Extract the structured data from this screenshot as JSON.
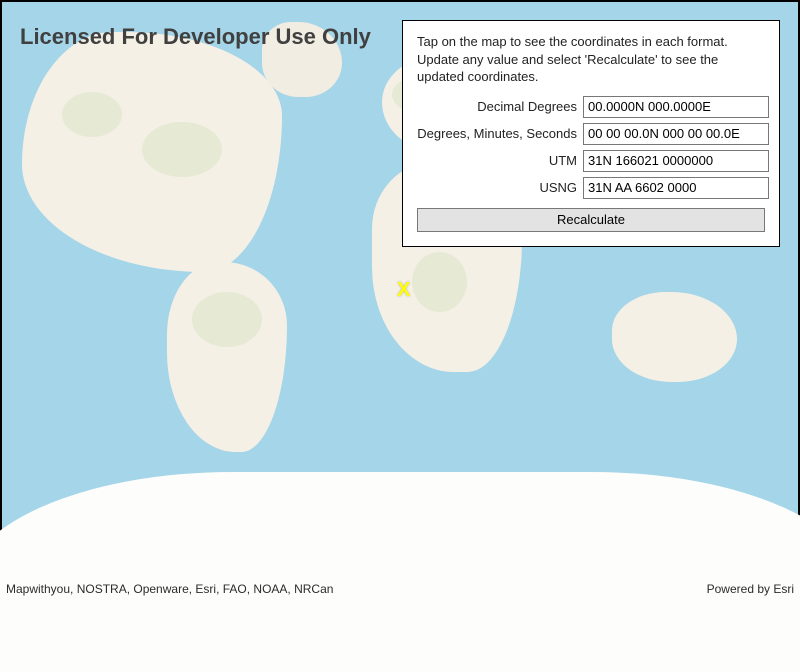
{
  "watermark": "Licensed For Developer Use Only",
  "attribution_left": "Mapwithyou, NOSTRA, Openware, Esri, FAO, NOAA, NRCan",
  "attribution_right": "Powered by Esri",
  "marker_glyph": "X",
  "panel": {
    "instructions": "Tap on the map to see the coordinates in each format. Update any value and select 'Recalculate' to see the updated coordinates.",
    "fields": {
      "dd": {
        "label": "Decimal Degrees",
        "value": "00.0000N 000.0000E"
      },
      "dms": {
        "label": "Degrees, Minutes, Seconds",
        "value": "00 00 00.0N 000 00 00.0E"
      },
      "utm": {
        "label": "UTM",
        "value": "31N 166021 0000000"
      },
      "usng": {
        "label": "USNG",
        "value": "31N AA 6602 0000"
      }
    },
    "recalculate_label": "Recalculate"
  }
}
